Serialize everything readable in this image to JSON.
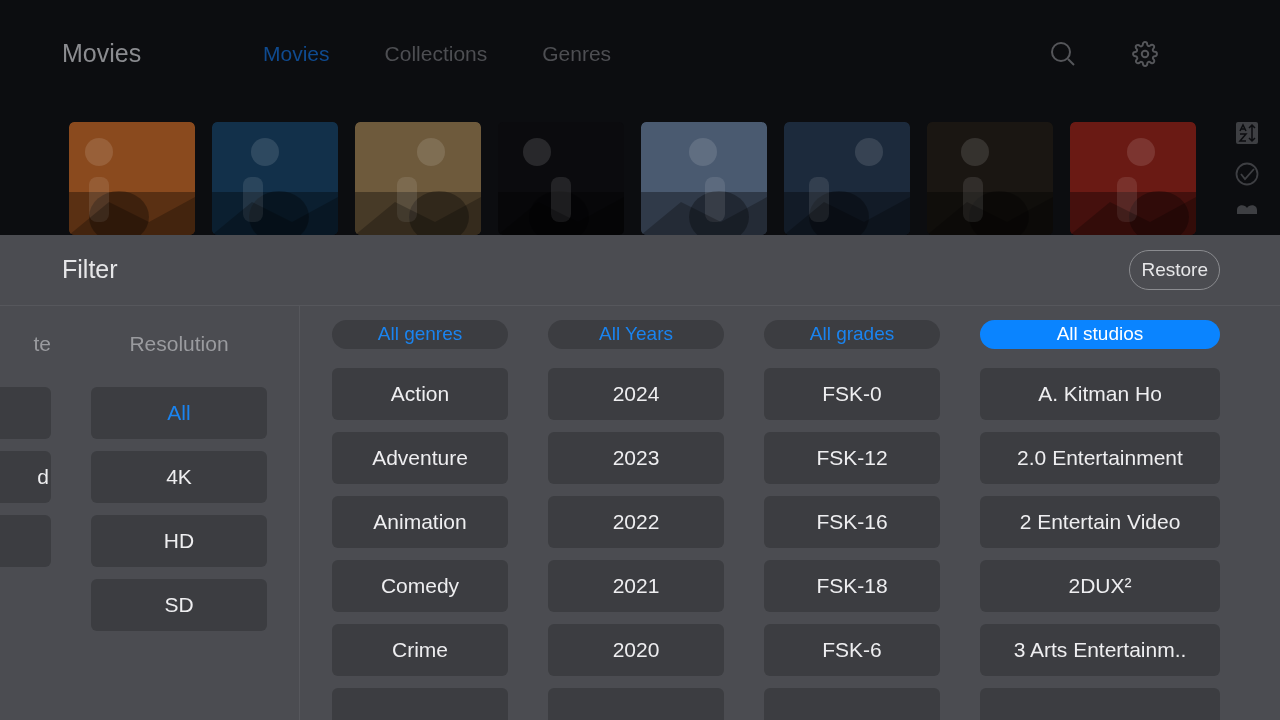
{
  "header": {
    "title": "Movies",
    "tabs": [
      {
        "label": "Movies",
        "selected": true
      },
      {
        "label": "Collections",
        "selected": false
      },
      {
        "label": "Genres",
        "selected": false
      }
    ]
  },
  "filter": {
    "title": "Filter",
    "restore": "Restore",
    "cut_column": {
      "header": "te",
      "cells": [
        {
          "kind": "blank"
        },
        {
          "kind": "text",
          "label": "d"
        },
        {
          "kind": "blank"
        }
      ]
    },
    "resolution": {
      "header": "Resolution",
      "options": [
        {
          "label": "All",
          "selected": true
        },
        {
          "label": "4K",
          "selected": false
        },
        {
          "label": "HD",
          "selected": false
        },
        {
          "label": "SD",
          "selected": false
        }
      ]
    },
    "columns": [
      {
        "header": "All genres",
        "selected": false,
        "options": [
          "Action",
          "Adventure",
          "Animation",
          "Comedy",
          "Crime"
        ]
      },
      {
        "header": "All Years",
        "selected": false,
        "options": [
          "2024",
          "2023",
          "2022",
          "2021",
          "2020"
        ]
      },
      {
        "header": "All grades",
        "selected": false,
        "options": [
          "FSK-0",
          "FSK-12",
          "FSK-16",
          "FSK-18",
          "FSK-6"
        ]
      },
      {
        "header": "All studios",
        "selected": true,
        "options": [
          "A. Kitman Ho",
          "2.0 Entertainment",
          "2 Entertain Video",
          "2DUX²",
          "3 Arts Entertainm.."
        ]
      }
    ]
  }
}
